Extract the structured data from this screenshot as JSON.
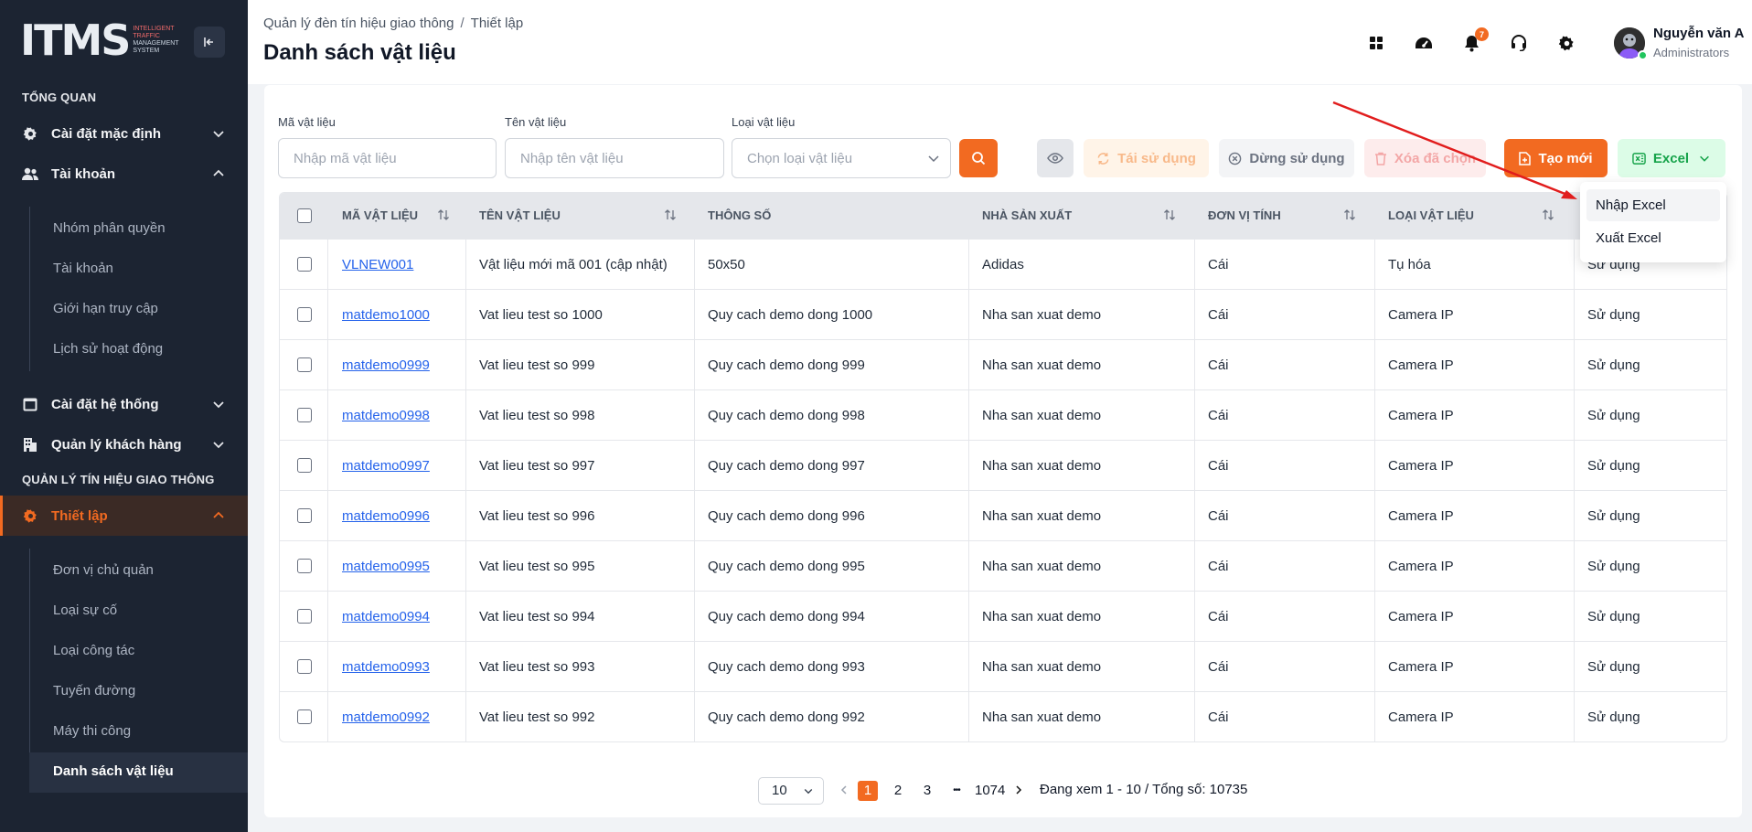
{
  "logo": {
    "mark": "ITMS",
    "line1": "INTELLIGENT",
    "line2": "TRAFFIC",
    "line3": "MANAGEMENT",
    "line4": "SYSTEM"
  },
  "sidebar": {
    "section_overview": "TỔNG QUAN",
    "default_settings": "Cài đặt mặc định",
    "account": "Tài khoản",
    "account_sub": [
      "Nhóm phân quyền",
      "Tài khoản",
      "Giới hạn truy cập",
      "Lịch sử hoạt động"
    ],
    "system_settings": "Cài đặt hệ thống",
    "customer_mgmt": "Quản lý khách hàng",
    "section_traffic": "QUẢN LÝ TÍN HIỆU GIAO THÔNG",
    "setup": "Thiết lập",
    "setup_sub": [
      "Đơn vị chủ quản",
      "Loại sự cố",
      "Loại công tác",
      "Tuyến đường",
      "Máy thi công",
      "Danh sách vật liệu"
    ]
  },
  "header": {
    "breadcrumb": [
      "Quản lý đèn tín hiệu giao thông",
      "Thiết lập"
    ],
    "breadcrumb_sep": "/",
    "title": "Danh sách vật liệu",
    "notification_count": "7",
    "user_name": "Nguyễn văn A",
    "user_role": "Administrators"
  },
  "filters": {
    "code_label": "Mã vật liệu",
    "code_placeholder": "Nhập mã vật liệu",
    "name_label": "Tên vật liệu",
    "name_placeholder": "Nhập tên vật liệu",
    "type_label": "Loại vật liệu",
    "type_placeholder": "Chọn loại vật liệu"
  },
  "toolbar": {
    "reuse": "Tái sử dụng",
    "stop": "Dừng sử dụng",
    "delete": "Xóa đã chọn",
    "create": "Tạo mới",
    "excel": "Excel"
  },
  "excel_menu": [
    "Nhập Excel",
    "Xuất Excel"
  ],
  "table": {
    "columns": [
      "MÃ VẬT LIỆU",
      "TÊN VẬT LIỆU",
      "THÔNG SỐ",
      "NHÀ SẢN XUẤT",
      "ĐƠN VỊ TÍNH",
      "LOẠI VẬT LIỆU"
    ],
    "rows": [
      [
        "VLNEW001",
        "Vật liệu mới mã 001 (cập nhật)",
        "50x50",
        "Adidas",
        "Cái",
        "Tụ hóa",
        "Sử dụng"
      ],
      [
        "matdemo1000",
        "Vat lieu test so 1000",
        "Quy cach demo dong 1000",
        "Nha san xuat demo",
        "Cái",
        "Camera IP",
        "Sử dụng"
      ],
      [
        "matdemo0999",
        "Vat lieu test so 999",
        "Quy cach demo dong 999",
        "Nha san xuat demo",
        "Cái",
        "Camera IP",
        "Sử dụng"
      ],
      [
        "matdemo0998",
        "Vat lieu test so 998",
        "Quy cach demo dong 998",
        "Nha san xuat demo",
        "Cái",
        "Camera IP",
        "Sử dụng"
      ],
      [
        "matdemo0997",
        "Vat lieu test so 997",
        "Quy cach demo dong 997",
        "Nha san xuat demo",
        "Cái",
        "Camera IP",
        "Sử dụng"
      ],
      [
        "matdemo0996",
        "Vat lieu test so 996",
        "Quy cach demo dong 996",
        "Nha san xuat demo",
        "Cái",
        "Camera IP",
        "Sử dụng"
      ],
      [
        "matdemo0995",
        "Vat lieu test so 995",
        "Quy cach demo dong 995",
        "Nha san xuat demo",
        "Cái",
        "Camera IP",
        "Sử dụng"
      ],
      [
        "matdemo0994",
        "Vat lieu test so 994",
        "Quy cach demo dong 994",
        "Nha san xuat demo",
        "Cái",
        "Camera IP",
        "Sử dụng"
      ],
      [
        "matdemo0993",
        "Vat lieu test so 993",
        "Quy cach demo dong 993",
        "Nha san xuat demo",
        "Cái",
        "Camera IP",
        "Sử dụng"
      ],
      [
        "matdemo0992",
        "Vat lieu test so 992",
        "Quy cach demo dong 992",
        "Nha san xuat demo",
        "Cái",
        "Camera IP",
        "Sử dụng"
      ]
    ]
  },
  "pagination": {
    "page_size": "10",
    "pages": [
      "1",
      "2",
      "3"
    ],
    "ellipsis": "•••",
    "last_page": "1074",
    "info": "Đang xem 1 - 10 / Tổng số: 10735"
  },
  "colors": {
    "accent": "#f26a21",
    "sidebar_bg": "#1c2432",
    "excel_green": "#16a34a",
    "link": "#2563eb",
    "annotation_arrow": "#e11d1d"
  },
  "icons": [
    "search-icon",
    "eye-icon",
    "refresh-icon",
    "cancel-circle-icon",
    "trash-icon",
    "file-add-icon",
    "excel-icon",
    "grid-icon",
    "speedometer-icon",
    "bell-icon",
    "headset-icon",
    "gear-icon",
    "sort-icon"
  ]
}
